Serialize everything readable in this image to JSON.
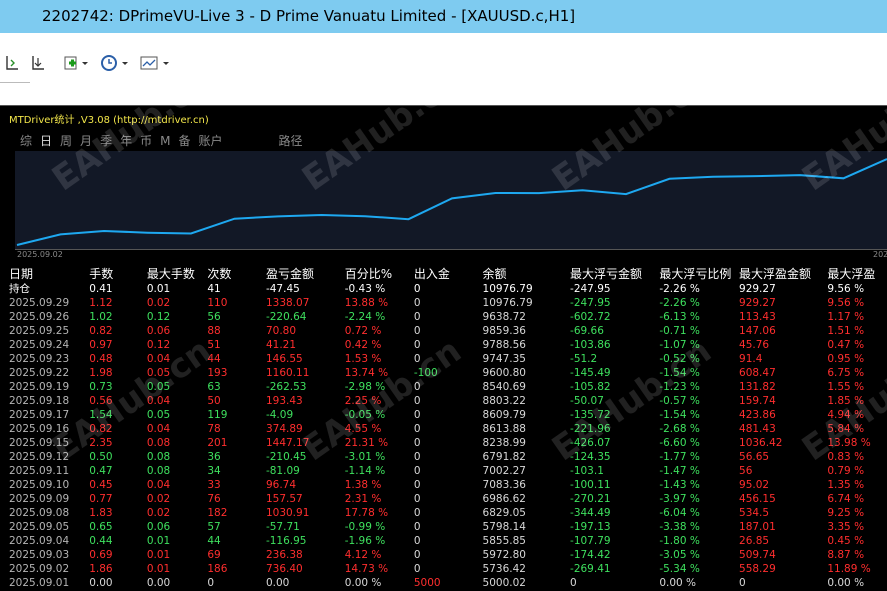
{
  "window": {
    "title": "2202742: DPrimeVU-Live 3 - D Prime Vanuatu Limited - [XAUUSD.c,H1]"
  },
  "toolbar": {
    "icons": [
      "chart-shift-icon",
      "autoscroll-icon",
      "indicators-icon",
      "periods-icon",
      "templates-icon"
    ]
  },
  "indicator": {
    "name": "MTDriver统计 ,V3.08 (http://mtdriver.cn)"
  },
  "tabs": [
    "综",
    "日",
    "周",
    "月",
    "季",
    "年",
    "币",
    "M",
    "备",
    "账户",
    "路径"
  ],
  "active_tab": "日",
  "chart": {
    "start_label": "2025.09.02",
    "end_label": "202",
    "line_color": "#1ea8f0"
  },
  "chart_data": {
    "type": "line",
    "series": [
      {
        "values": [
          5000.02,
          5736.42,
          5972.8,
          5855.85,
          5798.14,
          6829.05,
          6986.62,
          7083.36,
          7002.27,
          6791.82,
          8238.99,
          8613.88,
          8609.79,
          8803.22,
          8540.69,
          9600.8,
          9747.35,
          9788.56,
          9859.36,
          9638.72,
          10976.79
        ]
      }
    ]
  },
  "table": {
    "headers": [
      "日期",
      "手数",
      "最大手数",
      "次数",
      "盈亏金额",
      "百分比%",
      "出入金",
      "余额",
      "最大浮亏金额",
      "最大浮亏比例",
      "最大浮盈金额",
      "最大浮盈"
    ],
    "holding": {
      "date": "持仓",
      "lots": "0.41",
      "maxlots": "0.01",
      "count": "41",
      "pl": "-47.45",
      "pct": "-0.43 %",
      "io": "0",
      "bal": "10976.79",
      "fl": "-247.95",
      "flp": "-2.26 %",
      "fp": "929.27",
      "fpp": "9.56 %"
    },
    "rows": [
      {
        "date": "2025.09.29",
        "lots": "1.12",
        "maxlots": "0.02",
        "count": "110",
        "pl": "1338.07",
        "pct": "13.88 %",
        "io": "0",
        "bal": "10976.79",
        "fl": "-247.95",
        "flp": "-2.26 %",
        "fp": "929.27",
        "fpp": "9.56 %",
        "dir": "r"
      },
      {
        "date": "2025.09.26",
        "lots": "1.02",
        "maxlots": "0.12",
        "count": "56",
        "pl": "-220.64",
        "pct": "-2.24 %",
        "io": "0",
        "bal": "9638.72",
        "fl": "-602.72",
        "flp": "-6.13 %",
        "fp": "113.43",
        "fpp": "1.17 %",
        "dir": "g"
      },
      {
        "date": "2025.09.25",
        "lots": "0.82",
        "maxlots": "0.06",
        "count": "88",
        "pl": "70.80",
        "pct": "0.72 %",
        "io": "0",
        "bal": "9859.36",
        "fl": "-69.66",
        "flp": "-0.71 %",
        "fp": "147.06",
        "fpp": "1.51 %",
        "dir": "r"
      },
      {
        "date": "2025.09.24",
        "lots": "0.97",
        "maxlots": "0.12",
        "count": "51",
        "pl": "41.21",
        "pct": "0.42 %",
        "io": "0",
        "bal": "9788.56",
        "fl": "-103.86",
        "flp": "-1.07 %",
        "fp": "45.76",
        "fpp": "0.47 %",
        "dir": "r"
      },
      {
        "date": "2025.09.23",
        "lots": "0.48",
        "maxlots": "0.04",
        "count": "44",
        "pl": "146.55",
        "pct": "1.53 %",
        "io": "0",
        "bal": "9747.35",
        "fl": "-51.2",
        "flp": "-0.52 %",
        "fp": "91.4",
        "fpp": "0.95 %",
        "dir": "r"
      },
      {
        "date": "2025.09.22",
        "lots": "1.98",
        "maxlots": "0.05",
        "count": "193",
        "pl": "1160.11",
        "pct": "13.74 %",
        "io": "-100",
        "bal": "9600.80",
        "fl": "-145.49",
        "flp": "-1.54 %",
        "fp": "608.47",
        "fpp": "6.75 %",
        "dir": "r"
      },
      {
        "date": "2025.09.19",
        "lots": "0.73",
        "maxlots": "0.05",
        "count": "63",
        "pl": "-262.53",
        "pct": "-2.98 %",
        "io": "0",
        "bal": "8540.69",
        "fl": "-105.82",
        "flp": "-1.23 %",
        "fp": "131.82",
        "fpp": "1.55 %",
        "dir": "g"
      },
      {
        "date": "2025.09.18",
        "lots": "0.56",
        "maxlots": "0.04",
        "count": "50",
        "pl": "193.43",
        "pct": "2.25 %",
        "io": "0",
        "bal": "8803.22",
        "fl": "-50.07",
        "flp": "-0.57 %",
        "fp": "159.74",
        "fpp": "1.85 %",
        "dir": "r"
      },
      {
        "date": "2025.09.17",
        "lots": "1.54",
        "maxlots": "0.05",
        "count": "119",
        "pl": "-4.09",
        "pct": "-0.05 %",
        "io": "0",
        "bal": "8609.79",
        "fl": "-135.72",
        "flp": "-1.54 %",
        "fp": "423.86",
        "fpp": "4.94 %",
        "dir": "g"
      },
      {
        "date": "2025.09.16",
        "lots": "0.82",
        "maxlots": "0.04",
        "count": "78",
        "pl": "374.89",
        "pct": "4.55 %",
        "io": "0",
        "bal": "8613.88",
        "fl": "-221.96",
        "flp": "-2.68 %",
        "fp": "481.43",
        "fpp": "5.84 %",
        "dir": "r"
      },
      {
        "date": "2025.09.15",
        "lots": "2.35",
        "maxlots": "0.08",
        "count": "201",
        "pl": "1447.17",
        "pct": "21.31 %",
        "io": "0",
        "bal": "8238.99",
        "fl": "-426.07",
        "flp": "-6.60 %",
        "fp": "1036.42",
        "fpp": "13.98 %",
        "dir": "r"
      },
      {
        "date": "2025.09.12",
        "lots": "0.50",
        "maxlots": "0.08",
        "count": "36",
        "pl": "-210.45",
        "pct": "-3.01 %",
        "io": "0",
        "bal": "6791.82",
        "fl": "-124.35",
        "flp": "-1.77 %",
        "fp": "56.65",
        "fpp": "0.83 %",
        "dir": "g"
      },
      {
        "date": "2025.09.11",
        "lots": "0.47",
        "maxlots": "0.08",
        "count": "34",
        "pl": "-81.09",
        "pct": "-1.14 %",
        "io": "0",
        "bal": "7002.27",
        "fl": "-103.1",
        "flp": "-1.47 %",
        "fp": "56",
        "fpp": "0.79 %",
        "dir": "g"
      },
      {
        "date": "2025.09.10",
        "lots": "0.45",
        "maxlots": "0.04",
        "count": "33",
        "pl": "96.74",
        "pct": "1.38 %",
        "io": "0",
        "bal": "7083.36",
        "fl": "-100.11",
        "flp": "-1.43 %",
        "fp": "95.02",
        "fpp": "1.35 %",
        "dir": "r"
      },
      {
        "date": "2025.09.09",
        "lots": "0.77",
        "maxlots": "0.02",
        "count": "76",
        "pl": "157.57",
        "pct": "2.31 %",
        "io": "0",
        "bal": "6986.62",
        "fl": "-270.21",
        "flp": "-3.97 %",
        "fp": "456.15",
        "fpp": "6.74 %",
        "dir": "r"
      },
      {
        "date": "2025.09.08",
        "lots": "1.83",
        "maxlots": "0.02",
        "count": "182",
        "pl": "1030.91",
        "pct": "17.78 %",
        "io": "0",
        "bal": "6829.05",
        "fl": "-344.49",
        "flp": "-6.04 %",
        "fp": "534.5",
        "fpp": "9.25 %",
        "dir": "r"
      },
      {
        "date": "2025.09.05",
        "lots": "0.65",
        "maxlots": "0.06",
        "count": "57",
        "pl": "-57.71",
        "pct": "-0.99 %",
        "io": "0",
        "bal": "5798.14",
        "fl": "-197.13",
        "flp": "-3.38 %",
        "fp": "187.01",
        "fpp": "3.35 %",
        "dir": "g"
      },
      {
        "date": "2025.09.04",
        "lots": "0.44",
        "maxlots": "0.01",
        "count": "44",
        "pl": "-116.95",
        "pct": "-1.96 %",
        "io": "0",
        "bal": "5855.85",
        "fl": "-107.79",
        "flp": "-1.80 %",
        "fp": "26.85",
        "fpp": "0.45 %",
        "dir": "g"
      },
      {
        "date": "2025.09.03",
        "lots": "0.69",
        "maxlots": "0.01",
        "count": "69",
        "pl": "236.38",
        "pct": "4.12 %",
        "io": "0",
        "bal": "5972.80",
        "fl": "-174.42",
        "flp": "-3.05 %",
        "fp": "509.74",
        "fpp": "8.87 %",
        "dir": "r"
      },
      {
        "date": "2025.09.02",
        "lots": "1.86",
        "maxlots": "0.01",
        "count": "186",
        "pl": "736.40",
        "pct": "14.73 %",
        "io": "0",
        "bal": "5736.42",
        "fl": "-269.41",
        "flp": "-5.34 %",
        "fp": "558.29",
        "fpp": "11.89 %",
        "dir": "r"
      },
      {
        "date": "2025.09.01",
        "lots": "0.00",
        "maxlots": "0.00",
        "count": "0",
        "pl": "0.00",
        "pct": "0.00 %",
        "io": "5000",
        "bal": "5000.02",
        "fl": "0",
        "flp": "0.00 %",
        "fp": "0",
        "fpp": "0.00 %",
        "dir": "w"
      }
    ]
  },
  "watermark": "EAHub.cn"
}
